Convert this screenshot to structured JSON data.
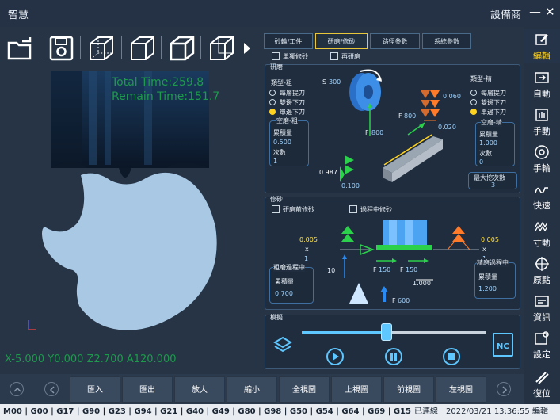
{
  "titlebar": {
    "app_title": "智慧",
    "device_label": "設備商",
    "minimize": "—",
    "close": "✕"
  },
  "toolbar": {
    "icons": [
      "open-folder-icon",
      "save-icon",
      "wireframe-cube-icon",
      "wireframe-cube-icon",
      "solid-cube-icon",
      "solid-cube-icon",
      "play-small-icon"
    ]
  },
  "simulation": {
    "total_time": "Total Time:259.8",
    "remain_time": "Remain Time:151.7",
    "coords": "X-5.000 Y0.000 Z2.700 A120.000"
  },
  "tabs": [
    {
      "label": "砂輪/工件",
      "active": false
    },
    {
      "label": "研磨/修砂",
      "active": true
    },
    {
      "label": "路徑參數",
      "active": false
    },
    {
      "label": "系統參數",
      "active": false
    }
  ],
  "grinding": {
    "single_dress": "單獨修砂",
    "regrind": "再研磨",
    "section_title": "研磨",
    "rough_type_label": "類型-粗",
    "fine_type_label": "類型-精",
    "rough_options": [
      "每層提刀",
      "雙邊下刀",
      "單邊下刀"
    ],
    "rough_selected": 2,
    "fine_options": [
      "每層提刀",
      "雙邊下刀",
      "單邊下刀"
    ],
    "fine_selected": 2,
    "rough_air_title": "空磨-粗",
    "fine_air_title": "空磨-精",
    "feed_label": "累積量",
    "count_label": "次數",
    "rough_feed": "0.500",
    "rough_count": "1",
    "fine_feed": "1.000",
    "fine_count": "0",
    "max_cut_label": "最大挖次數",
    "max_cut_value": "3",
    "s_label": "S",
    "s_value": "300",
    "f1_label": "F",
    "f1_value": "800",
    "f2_label": "F",
    "f2_value": "800",
    "d1": "0.987",
    "d2": "0.100",
    "d3": "0.060",
    "d4": "0.020"
  },
  "dressing": {
    "section_title": "修砂",
    "pre_dress": "研磨前修砂",
    "during_dress": "過程中修砂",
    "rough_during_title": "粗磨過程中",
    "fine_during_title": "精磨過程中",
    "feed_label": "累積量",
    "rough_value": "0.700",
    "fine_value": "1.200",
    "v_005a": "0.005",
    "x1": "x",
    "one_a": "1",
    "v_005b": "0.005",
    "x2": "x",
    "one_b": "1",
    "ten": "10",
    "f150a": "150",
    "f150b": "150",
    "f_label": "F",
    "one_000": "1.000",
    "f600": "600"
  },
  "simulate": {
    "section_title": "模擬",
    "progress": 0.46,
    "nc_label": "NC"
  },
  "rnav": [
    {
      "label": "編輯",
      "icon": "edit-icon",
      "accent": true
    },
    {
      "label": "自動",
      "icon": "auto-icon"
    },
    {
      "label": "手動",
      "icon": "hand-icon"
    },
    {
      "label": "手輪",
      "icon": "handwheel-icon"
    },
    {
      "label": "快速",
      "icon": "rapid-icon"
    },
    {
      "label": "寸動",
      "icon": "jog-icon"
    },
    {
      "label": "原點",
      "icon": "origin-icon"
    },
    {
      "label": "資訊",
      "icon": "info-icon"
    },
    {
      "label": "設定",
      "icon": "settings-icon"
    },
    {
      "label": "復位",
      "icon": "reset-icon"
    }
  ],
  "bottom_buttons": [
    "匯入",
    "匯出",
    "放大",
    "縮小",
    "全視圖",
    "上視圖",
    "前視圖",
    "左視圖"
  ],
  "status": {
    "gcodes": "M00 | G00 | G17 | G90 | G23 | G94 | G21 | G40 | G49 | G80 | G98 | G50 | G54 | G64 | G69 | G15",
    "connection": "已連線",
    "datetime": "2022/03/21 13:36:55",
    "mode": "編輯"
  },
  "colors": {
    "accent_yellow": "#e9c73a",
    "sim_green": "#1d9a4b",
    "part_blue": "#a8c8e4",
    "panel_bg": "#1f2d3e"
  }
}
